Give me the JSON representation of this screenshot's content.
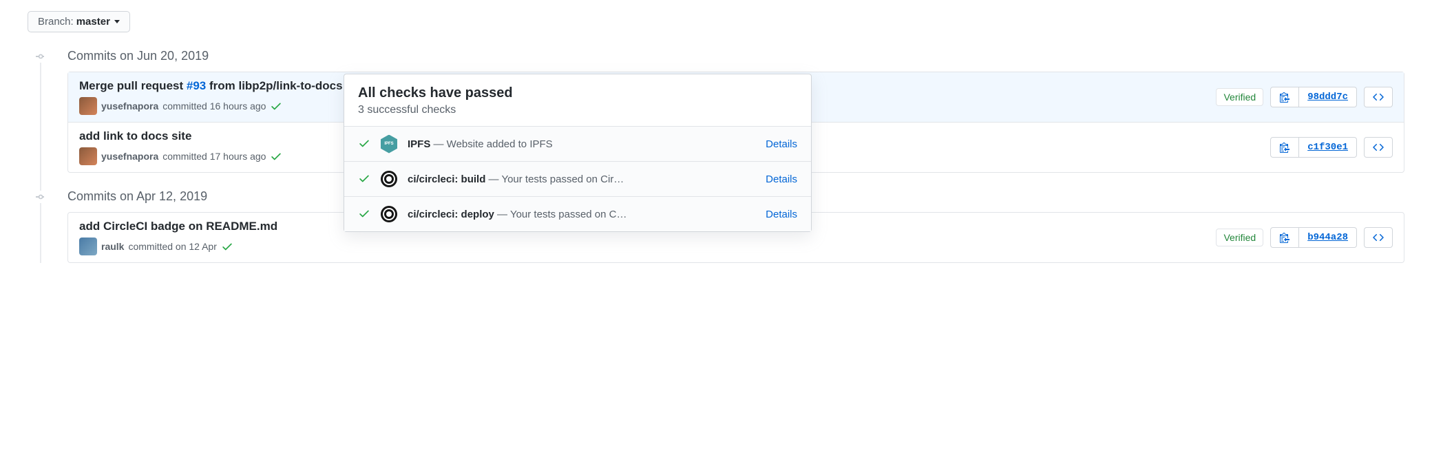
{
  "branch": {
    "label": "Branch:",
    "value": "master"
  },
  "groups": [
    {
      "title": "Commits on Jun 20, 2019",
      "commits": [
        {
          "title_prefix": "Merge pull request ",
          "pr": "#93",
          "title_suffix": " from libp2p/link-to-docs",
          "has_ellipsis": true,
          "author": "yusefnapora",
          "meta": "committed 16 hours ago",
          "verified": "Verified",
          "sha": "98ddd7c",
          "highlighted": true,
          "avatar_class": ""
        },
        {
          "title": "add link to docs site",
          "author": "yusefnapora",
          "meta": "committed 17 hours ago",
          "sha": "c1f30e1",
          "avatar_class": ""
        }
      ]
    },
    {
      "title": "Commits on Apr 12, 2019",
      "commits": [
        {
          "title": "add CircleCI badge on README.md",
          "author": "raulk",
          "meta": "committed on 12 Apr",
          "verified": "Verified",
          "sha": "b944a28",
          "avatar_class": "alt"
        }
      ]
    }
  ],
  "popover": {
    "title": "All checks have passed",
    "subtitle": "3 successful checks",
    "checks": [
      {
        "logo": "ipfs",
        "name": "IPFS",
        "desc": " — Website added to IPFS",
        "details": "Details"
      },
      {
        "logo": "circleci",
        "name": "ci/circleci: build",
        "desc": " — Your tests passed on Cir…",
        "details": "Details"
      },
      {
        "logo": "circleci",
        "name": "ci/circleci: deploy",
        "desc": " — Your tests passed on C…",
        "details": "Details"
      }
    ]
  }
}
